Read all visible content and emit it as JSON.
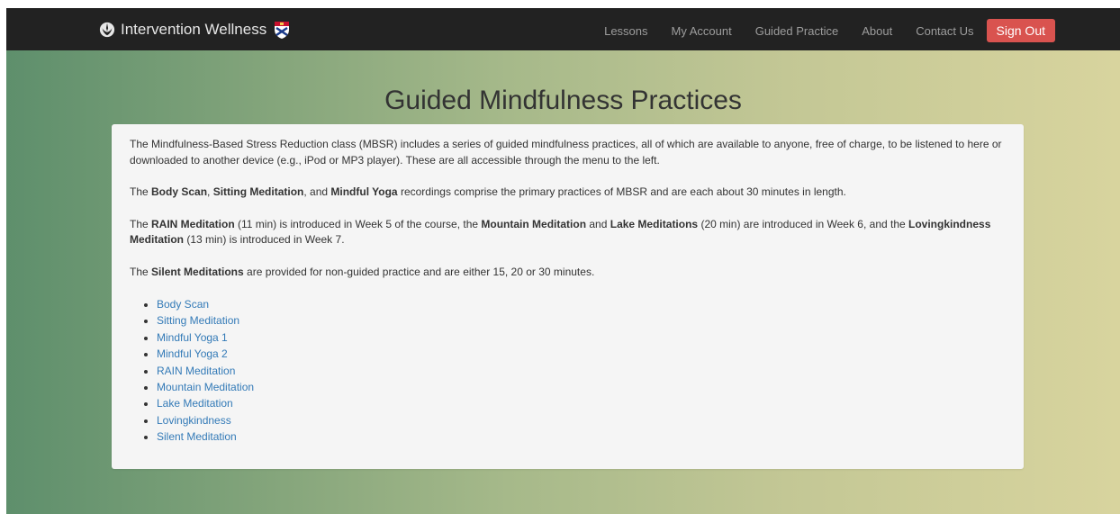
{
  "navbar": {
    "brand": "Intervention Wellness",
    "links": [
      "Lessons",
      "My Account",
      "Guided Practice",
      "About",
      "Contact Us"
    ],
    "sign_out": "Sign Out"
  },
  "page_title": "Guided Mindfulness Practices",
  "intro": {
    "p1": "The Mindfulness-Based Stress Reduction class (MBSR) includes a series of guided mindfulness practices, all of which are available to anyone, free of charge, to be listened to here or downloaded to another device (e.g., iPod or MP3 player). These are all accessible through the menu to the left.",
    "p2_a": "The ",
    "p2_b1": "Body Scan",
    "p2_c": ", ",
    "p2_b2": "Sitting Meditation",
    "p2_d": ", and ",
    "p2_b3": "Mindful Yoga",
    "p2_e": " recordings comprise the primary practices of MBSR and are each about 30 minutes in length.",
    "p3_a": "The ",
    "p3_b1": "RAIN Meditation",
    "p3_c": " (11 min) is introduced in Week 5 of the course, the ",
    "p3_b2": "Mountain Meditation",
    "p3_d": " and ",
    "p3_b3": "Lake Meditations",
    "p3_e": " (20 min) are introduced in Week 6, and the ",
    "p3_b4": "Lovingkindness Meditation",
    "p3_f": " (13 min) is introduced in Week 7.",
    "p4_a": "The ",
    "p4_b1": "Silent Meditations",
    "p4_c": " are provided for non-guided practice and are either 15, 20 or 30 minutes."
  },
  "practices": [
    "Body Scan",
    "Sitting Meditation",
    "Mindful Yoga 1",
    "Mindful Yoga 2",
    "RAIN Meditation",
    "Mountain Meditation",
    "Lake Meditation",
    "Lovingkindness",
    "Silent Meditation"
  ],
  "colors": {
    "navbar_bg": "#222222",
    "signout_bg": "#d9534f",
    "link": "#337ab7"
  },
  "icons": {
    "brand": "rebel-alliance-icon",
    "crest": "university-crest-icon"
  }
}
